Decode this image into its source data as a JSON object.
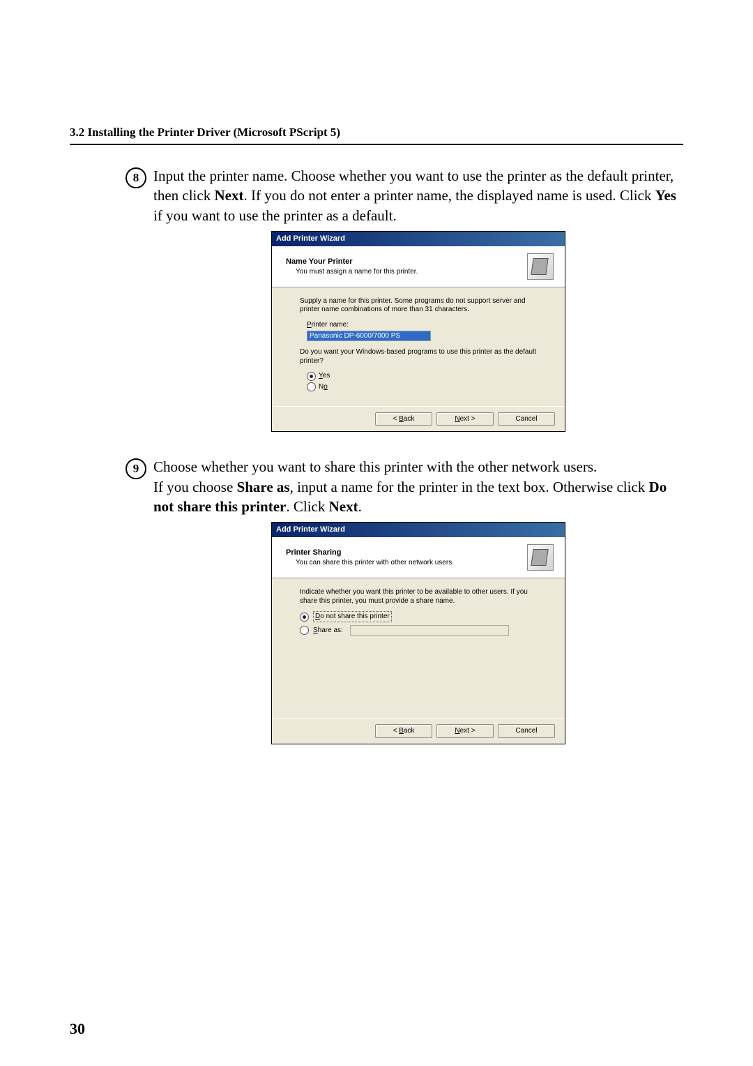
{
  "section_header": "3.2    Installing the Printer Driver (Microsoft PScript 5)",
  "page_number": "30",
  "step8": {
    "num": "8",
    "text_before": "Input the printer name. Choose whether you want to use the printer as the default printer, then click ",
    "bold1": "Next",
    "text_mid": ". If you do not enter a printer name, the displayed name is used. Click ",
    "bold2": "Yes",
    "text_after": " if you want to use the printer as a default."
  },
  "wiz1": {
    "title": "Add Printer Wizard",
    "header_title": "Name Your Printer",
    "header_sub": "You must assign a name for this printer.",
    "para": "Supply a name for this printer. Some programs do not support server and printer name combinations of more than 31 characters.",
    "field_label": "Printer name:",
    "field_value": "Panasonic DP-6000/7000 PS",
    "question": "Do you want your Windows-based programs to use this printer as the default printer?",
    "opt_yes": "Yes",
    "opt_no": "No",
    "back": "< Back",
    "next": "Next >",
    "cancel": "Cancel"
  },
  "step9": {
    "num": "9",
    "line1": "Choose whether you want to share this printer with the other network users.",
    "l2_a": "If you choose ",
    "l2_b": "Share as",
    "l2_c": ", input a name for the printer in the text box. Otherwise click ",
    "l2_d": "Do not share this printer",
    "l2_e": ". Click ",
    "l2_f": "Next",
    "l2_g": "."
  },
  "wiz2": {
    "title": "Add Printer Wizard",
    "header_title": "Printer Sharing",
    "header_sub": "You can share this printer with other network users.",
    "para": "Indicate whether you want this printer to be available to other users. If you share this printer, you must provide a share name.",
    "opt_noshare": "Do not share this printer",
    "opt_shareas": "Share as:",
    "back": "< Back",
    "next": "Next >",
    "cancel": "Cancel"
  }
}
